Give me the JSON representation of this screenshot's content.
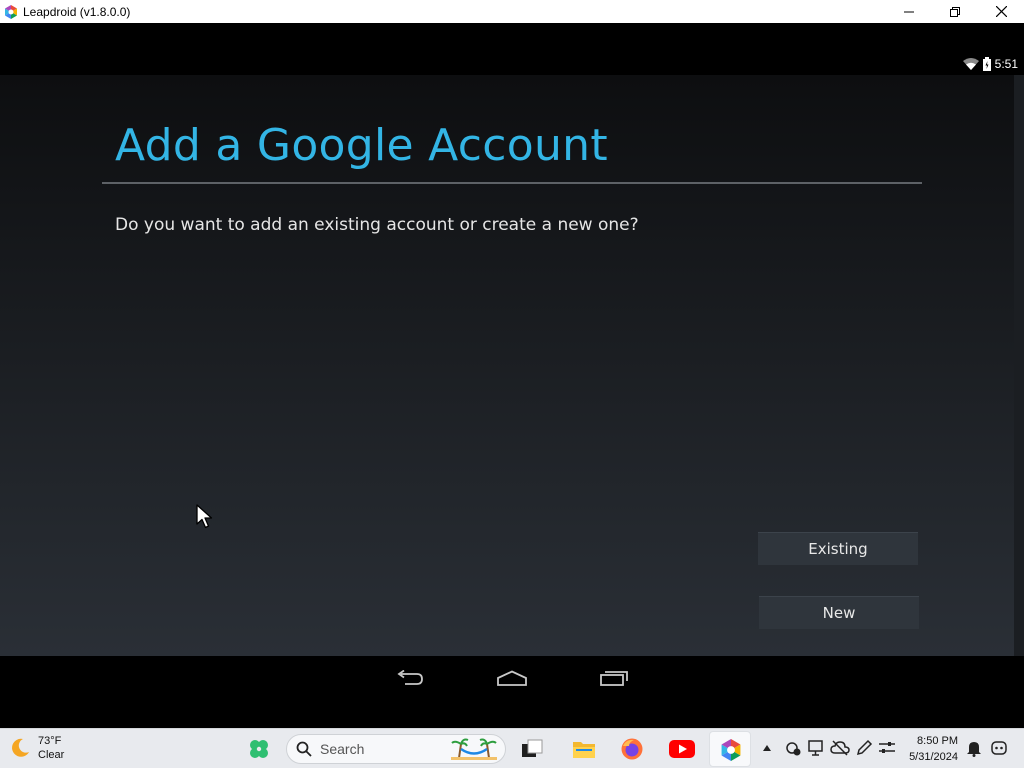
{
  "window": {
    "title": "Leapdroid (v1.8.0.0)",
    "controls": [
      "minimize",
      "restore",
      "close"
    ]
  },
  "status_bar": {
    "time": "5:51",
    "icons": [
      "wifi-icon",
      "battery-icon"
    ]
  },
  "dialog": {
    "heading": "Add a Google Account",
    "question": "Do you want to add an existing account or create a new one?",
    "buttons": {
      "existing": "Existing",
      "new": "New"
    }
  },
  "nav_bar": {
    "icons": [
      "back-icon",
      "home-icon",
      "recents-icon"
    ]
  },
  "taskbar": {
    "weather": {
      "temperature": "73°F",
      "condition": "Clear"
    },
    "search_placeholder": "Search",
    "clock": {
      "time": "8:50 PM",
      "date": "5/31/2024"
    }
  },
  "colors": {
    "accent": "#33b5e5",
    "youtube": "#ff0000"
  }
}
